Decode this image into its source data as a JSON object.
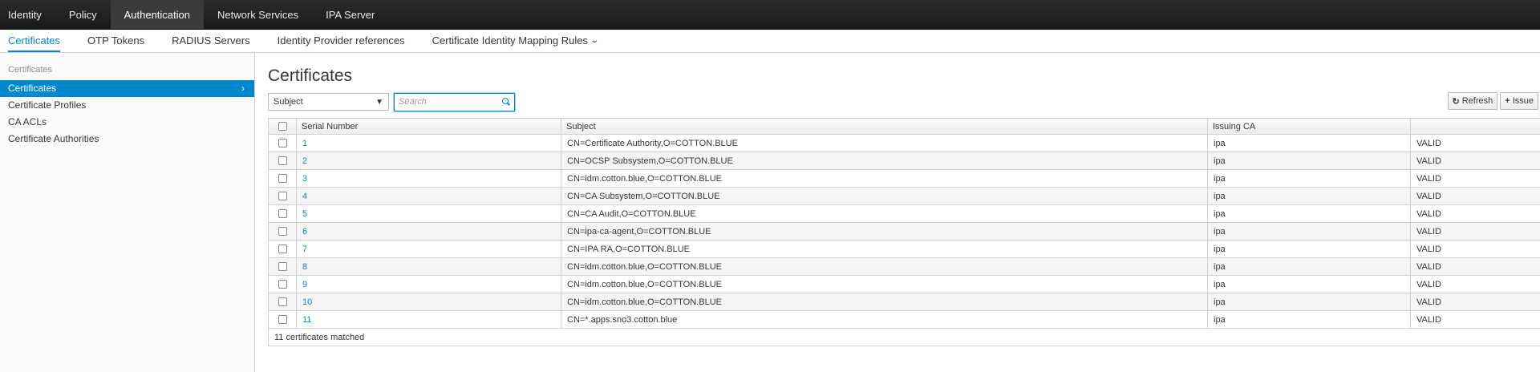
{
  "topnav": {
    "items": [
      {
        "label": "Identity"
      },
      {
        "label": "Policy"
      },
      {
        "label": "Authentication",
        "active": true
      },
      {
        "label": "Network Services"
      },
      {
        "label": "IPA Server"
      }
    ]
  },
  "subnav": {
    "items": [
      {
        "label": "Certificates",
        "active": true
      },
      {
        "label": "OTP Tokens"
      },
      {
        "label": "RADIUS Servers"
      },
      {
        "label": "Identity Provider references"
      },
      {
        "label": "Certificate Identity Mapping Rules"
      }
    ]
  },
  "sidebar": {
    "heading": "Certificates",
    "items": [
      {
        "label": "Certificates",
        "active": true
      },
      {
        "label": "Certificate Profiles"
      },
      {
        "label": "CA ACLs"
      },
      {
        "label": "Certificate Authorities"
      }
    ]
  },
  "main": {
    "title": "Certificates",
    "filter_select": "Subject",
    "search_placeholder": "Search",
    "refresh_label": "Refresh",
    "issue_label": "Issue"
  },
  "table": {
    "columns": [
      "Serial Number",
      "Subject",
      "Issuing CA",
      ""
    ],
    "rows": [
      {
        "serial": "1",
        "subject": "CN=Certificate Authority,O=COTTON.BLUE",
        "ca": "ipa",
        "status": "VALID"
      },
      {
        "serial": "2",
        "subject": "CN=OCSP Subsystem,O=COTTON.BLUE",
        "ca": "ipa",
        "status": "VALID"
      },
      {
        "serial": "3",
        "subject": "CN=idm.cotton.blue,O=COTTON.BLUE",
        "ca": "ipa",
        "status": "VALID"
      },
      {
        "serial": "4",
        "subject": "CN=CA Subsystem,O=COTTON.BLUE",
        "ca": "ipa",
        "status": "VALID"
      },
      {
        "serial": "5",
        "subject": "CN=CA Audit,O=COTTON.BLUE",
        "ca": "ipa",
        "status": "VALID"
      },
      {
        "serial": "6",
        "subject": "CN=ipa-ca-agent,O=COTTON.BLUE",
        "ca": "ipa",
        "status": "VALID"
      },
      {
        "serial": "7",
        "subject": "CN=IPA RA,O=COTTON.BLUE",
        "ca": "ipa",
        "status": "VALID"
      },
      {
        "serial": "8",
        "subject": "CN=idm.cotton.blue,O=COTTON.BLUE",
        "ca": "ipa",
        "status": "VALID"
      },
      {
        "serial": "9",
        "subject": "CN=idm.cotton.blue,O=COTTON.BLUE",
        "ca": "ipa",
        "status": "VALID"
      },
      {
        "serial": "10",
        "subject": "CN=idm.cotton.blue,O=COTTON.BLUE",
        "ca": "ipa",
        "status": "VALID"
      },
      {
        "serial": "11",
        "subject": "CN=*.apps.sno3.cotton.blue",
        "ca": "ipa",
        "status": "VALID"
      }
    ],
    "footer": "11 certificates matched"
  },
  "colors": {
    "accent": "#0088ce",
    "topnav_bg": "#1e1f21"
  }
}
